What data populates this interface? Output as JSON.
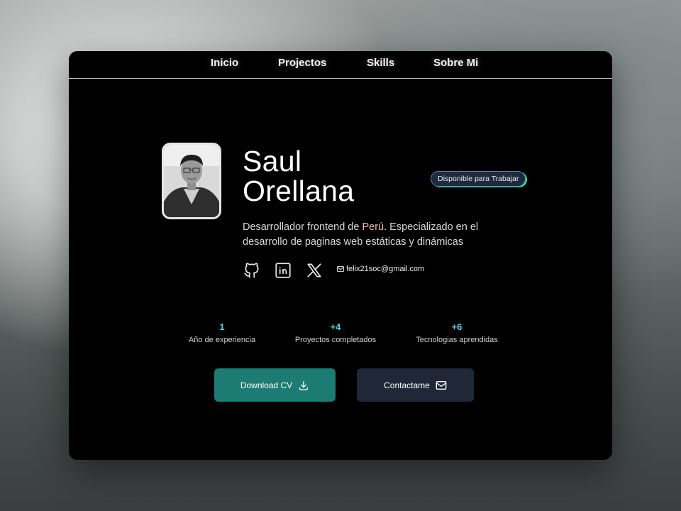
{
  "nav": {
    "items": [
      "Inicio",
      "Projectos",
      "Skills",
      "Sobre Mi"
    ]
  },
  "profile": {
    "name_line1": "Saul",
    "name_line2": "Orellana",
    "badge": "Disponible para Trabajar",
    "bio_part1": "Desarrollador frontend de ",
    "bio_highlight": "Perú",
    "bio_part2": ". Especializado en el desarrollo de paginas web estáticas y dinámicas",
    "email": "felix21soc@gmail.com"
  },
  "socials": {
    "icons": [
      "github-icon",
      "linkedin-icon",
      "x-icon",
      "mail-icon"
    ]
  },
  "stats": [
    {
      "value": "1",
      "label": "Año de experiencia"
    },
    {
      "value": "+4",
      "label": "Proyectos completados"
    },
    {
      "value": "+6",
      "label": "Tecnologias aprendidas"
    }
  ],
  "buttons": {
    "download_cv": "Download CV",
    "contact": "Contactame"
  },
  "colors": {
    "accent_cyan": "#4fd6e8",
    "cv_button": "#1c7c73",
    "contact_button": "#202838",
    "highlight": "#f2b3b3"
  }
}
